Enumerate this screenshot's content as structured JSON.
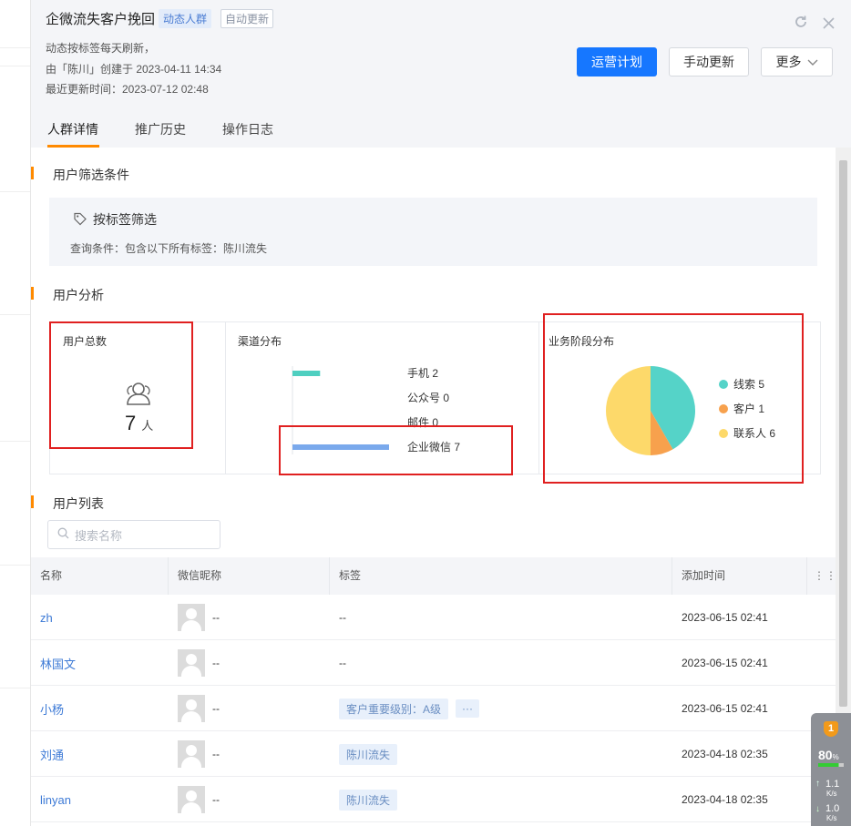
{
  "header": {
    "title": "企微流失客户挽回",
    "tag_dynamic": "动态人群",
    "tag_auto": "自动更新",
    "meta_line1": "动态按标签每天刷新，",
    "meta_line2": "由「陈川」创建于 2023-04-11 14:34",
    "meta_line3": "最近更新时间：2023-07-12 02:48",
    "btn_primary": "运营计划",
    "btn_manual": "手动更新",
    "btn_more": "更多"
  },
  "tabs": [
    "人群详情",
    "推广历史",
    "操作日志"
  ],
  "filter": {
    "section_title": "用户筛选条件",
    "heading": "按标签筛选",
    "query": "查询条件：包含以下所有标签：陈川流失"
  },
  "analysis": {
    "section_title": "用户分析",
    "total_title": "用户总数",
    "total_value": "7",
    "total_unit": "人",
    "channel_title": "渠道分布",
    "stage_title": "业务阶段分布"
  },
  "chart_data": [
    {
      "type": "bar",
      "title": "渠道分布",
      "categories": [
        "手机",
        "公众号",
        "邮件",
        "企业微信"
      ],
      "values": [
        2,
        0,
        0,
        7
      ],
      "colors": [
        "#4fcfc0",
        "#cccccc",
        "#cccccc",
        "#7aa9ec"
      ]
    },
    {
      "type": "pie",
      "title": "业务阶段分布",
      "categories": [
        "线索",
        "客户",
        "联系人"
      ],
      "values": [
        5,
        1,
        6
      ],
      "colors": [
        "#55d3c8",
        "#f7a14d",
        "#fdd96a"
      ]
    }
  ],
  "users": {
    "section_title": "用户列表",
    "search_placeholder": "搜索名称",
    "columns": [
      "名称",
      "微信昵称",
      "标签",
      "添加时间"
    ],
    "rows": [
      {
        "name": "zh",
        "nickname": "--",
        "tags": [
          "--"
        ],
        "time": "2023-06-15 02:41"
      },
      {
        "name": "林国文",
        "nickname": "--",
        "tags": [
          "--"
        ],
        "time": "2023-06-15 02:41"
      },
      {
        "name": "小杨",
        "nickname": "--",
        "tags": [
          "客户重要级别：A级",
          "···"
        ],
        "time": "2023-06-15 02:41"
      },
      {
        "name": "刘通",
        "nickname": "--",
        "tags": [
          "陈川流失"
        ],
        "time": "2023-04-18 02:35"
      },
      {
        "name": "linyan",
        "nickname": "--",
        "tags": [
          "陈川流失"
        ],
        "time": "2023-04-18 02:35"
      }
    ]
  },
  "widget": {
    "badge": "1",
    "percent": "80",
    "percent_unit": "%",
    "up_speed": "1.1",
    "down_speed": "1.0",
    "speed_unit": "K/s"
  }
}
